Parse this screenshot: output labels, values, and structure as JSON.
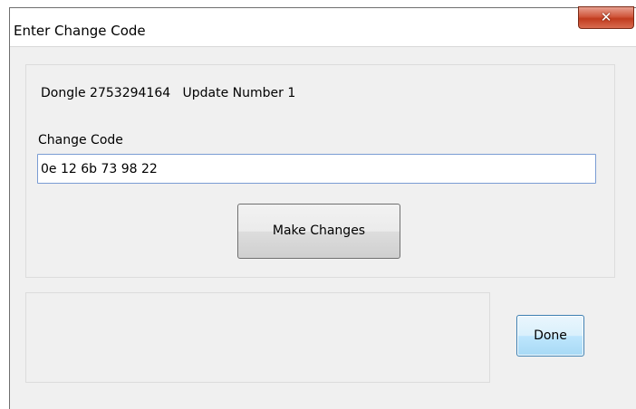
{
  "window": {
    "title": "Enter Change Code",
    "close_icon": "close-icon"
  },
  "info": {
    "dongle_text": "Dongle 2753294164   Update Number 1"
  },
  "change_code": {
    "label": "Change Code",
    "value": "0e 12 6b 73 98 22"
  },
  "buttons": {
    "make_changes": "Make Changes",
    "done": "Done"
  },
  "colors": {
    "close_button": "#c13b1e",
    "input_border": "#7a9cd3",
    "done_border": "#3c7fb1"
  }
}
